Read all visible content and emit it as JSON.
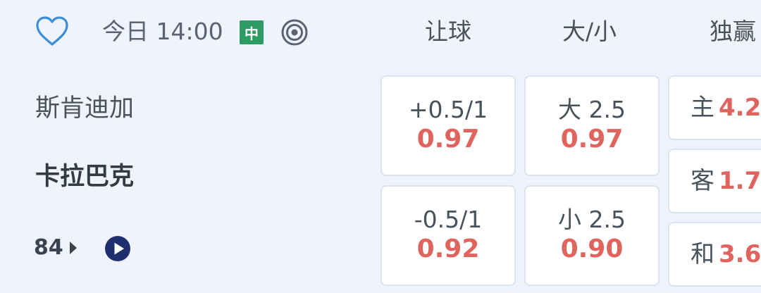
{
  "header": {
    "kickoff": "今日 14:00",
    "badge": "中",
    "columns": {
      "handicap": "让球",
      "over_under": "大/小",
      "winner": "独赢"
    }
  },
  "match": {
    "home_team": "斯肯迪加",
    "away_team": "卡拉巴克",
    "more_count": "84"
  },
  "odds": {
    "handicap_home": {
      "line": "+0.5/1",
      "odd": "0.97"
    },
    "handicap_away": {
      "line": "-0.5/1",
      "odd": "0.92"
    },
    "over": {
      "line": "大 2.5",
      "odd": "0.97"
    },
    "under": {
      "line": "小 2.5",
      "odd": "0.90"
    },
    "home": {
      "label": "主",
      "odd": "4.2"
    },
    "away": {
      "label": "客",
      "odd": "1.7"
    },
    "draw": {
      "label": "和",
      "odd": "3.6"
    }
  },
  "icons": {
    "favorite": "heart-outline-icon",
    "live_tracker": "target-icon",
    "play": "play-circle-icon",
    "more": "caret-right-icon"
  },
  "colors": {
    "background": "#eef3fd",
    "odds": "#e0645e",
    "badge": "#2e9a64",
    "accent_blue": "#3a8fd6",
    "navy": "#1f2f6e"
  }
}
